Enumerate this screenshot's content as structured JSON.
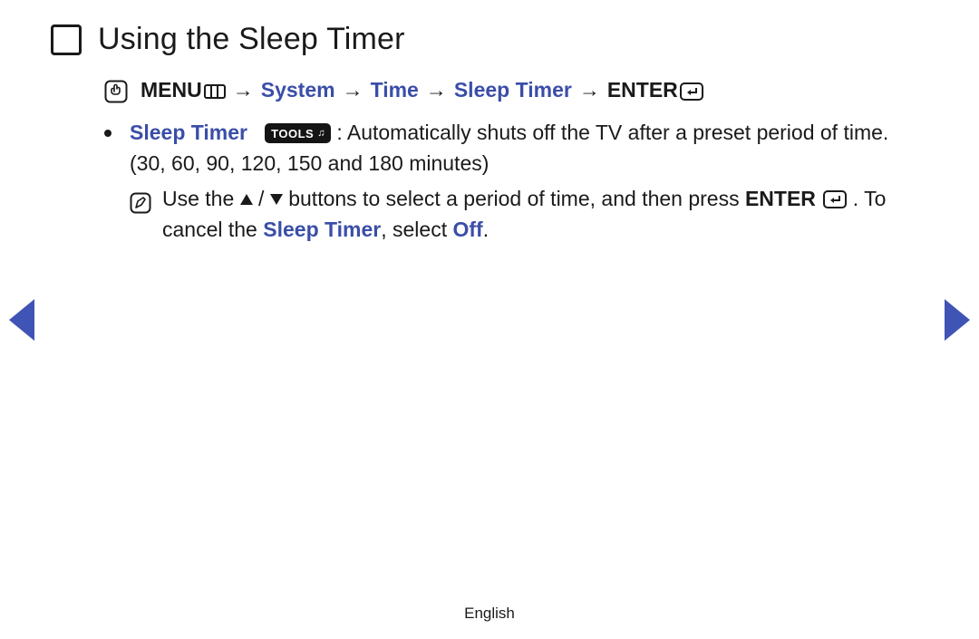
{
  "title": "Using the Sleep Timer",
  "breadcrumb": {
    "menu_label": "MENU",
    "arrow": "→",
    "system": "System",
    "time": "Time",
    "sleep_timer": "Sleep Timer",
    "enter_label": "ENTER"
  },
  "bullet": {
    "label": "Sleep Timer",
    "tools_badge": "TOOLS",
    "desc1": ": Automatically shuts off the TV after a preset period of time. (30, 60, 90, 120, 150 and 180 minutes)"
  },
  "note": {
    "part1": "Use the ",
    "part2": " buttons to select a period of time, and then press ",
    "enter_label": "ENTER",
    "part3": ". To cancel the ",
    "sleep_timer": "Sleep Timer",
    "part4": ", select ",
    "off": "Off",
    "part5": "."
  },
  "footer": "English"
}
